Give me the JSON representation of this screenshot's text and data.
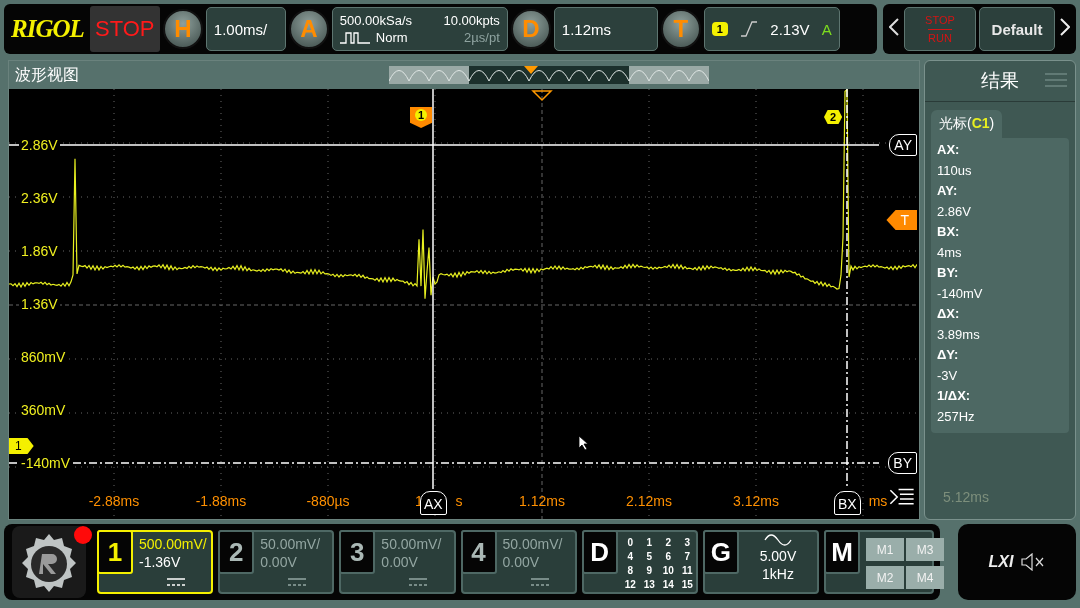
{
  "header": {
    "logo": "RIGOL",
    "run_state": "STOP",
    "horizontal": {
      "key": "H",
      "scale": "1.00ms/"
    },
    "acquire": {
      "key": "A",
      "sample_rate": "500.00kSa/s",
      "memory_depth": "10.00kpts",
      "mode": "Norm",
      "resolution": "2µs/pt"
    },
    "delay": {
      "key": "D",
      "value": "1.12ms"
    },
    "trigger": {
      "key": "T",
      "source": "1",
      "level": "2.13V",
      "sweep": "A"
    },
    "run_stop_button": {
      "top": "STOP",
      "bottom": "RUN"
    },
    "default_button": "Default"
  },
  "waveform_view": {
    "title": "波形视图",
    "y_labels": [
      "2.86V",
      "2.36V",
      "1.86V",
      "1.36V",
      "860mV",
      "360mV",
      "-140mV"
    ],
    "x_labels": [
      "-2.88ms",
      "-1.88ms",
      "-880µs",
      "1",
      "s",
      "1.12ms",
      "2.12ms",
      "3.12ms",
      "ms"
    ],
    "cursors": [
      {
        "label": "AY",
        "kind": "horizontal"
      },
      {
        "label": "BY",
        "kind": "horizontal"
      },
      {
        "label": "AX",
        "kind": "vertical"
      },
      {
        "label": "BX",
        "kind": "vertical"
      }
    ],
    "search_marks": [
      {
        "label": "1",
        "kind": "tag"
      },
      {
        "label": "2",
        "kind": "hexagon"
      }
    ],
    "trigger_level": "T",
    "channel_marker": "1"
  },
  "results": {
    "title": "结果",
    "tab": "光标(**C1**)",
    "items": [
      {
        "label": "AX:",
        "value": "110us"
      },
      {
        "label": "AY:",
        "value": "2.86V"
      },
      {
        "label": "BX:",
        "value": "4ms"
      },
      {
        "label": "BY:",
        "value": "-140mV"
      },
      {
        "label": "ΔX:",
        "value": "3.89ms"
      },
      {
        "label": "ΔY:",
        "value": "-3V"
      },
      {
        "label": "1/ΔX:",
        "value": "257Hz"
      }
    ],
    "axis_label_behind": "5.12ms"
  },
  "channels": [
    {
      "number": "1",
      "scale": "500.00mV/",
      "offset": "-1.36V",
      "on": true
    },
    {
      "number": "2",
      "scale": "50.00mV/",
      "offset": "0.00V",
      "on": false
    },
    {
      "number": "3",
      "scale": "50.00mV/",
      "offset": "0.00V",
      "on": false
    },
    {
      "number": "4",
      "scale": "50.00mV/",
      "offset": "0.00V",
      "on": false
    }
  ],
  "digital": {
    "key": "D",
    "bits": [
      "0",
      "1",
      "2",
      "3",
      "4",
      "5",
      "6",
      "7",
      "8",
      "9",
      "10",
      "11",
      "12",
      "13",
      "14",
      "15"
    ]
  },
  "generator": {
    "key": "G",
    "amplitude": "5.00V",
    "frequency": "1kHz"
  },
  "math": {
    "key": "M",
    "buttons": [
      "M1",
      "M3",
      "M2",
      "M4"
    ]
  },
  "status": {
    "lxi": "LXI",
    "muted": true
  }
}
